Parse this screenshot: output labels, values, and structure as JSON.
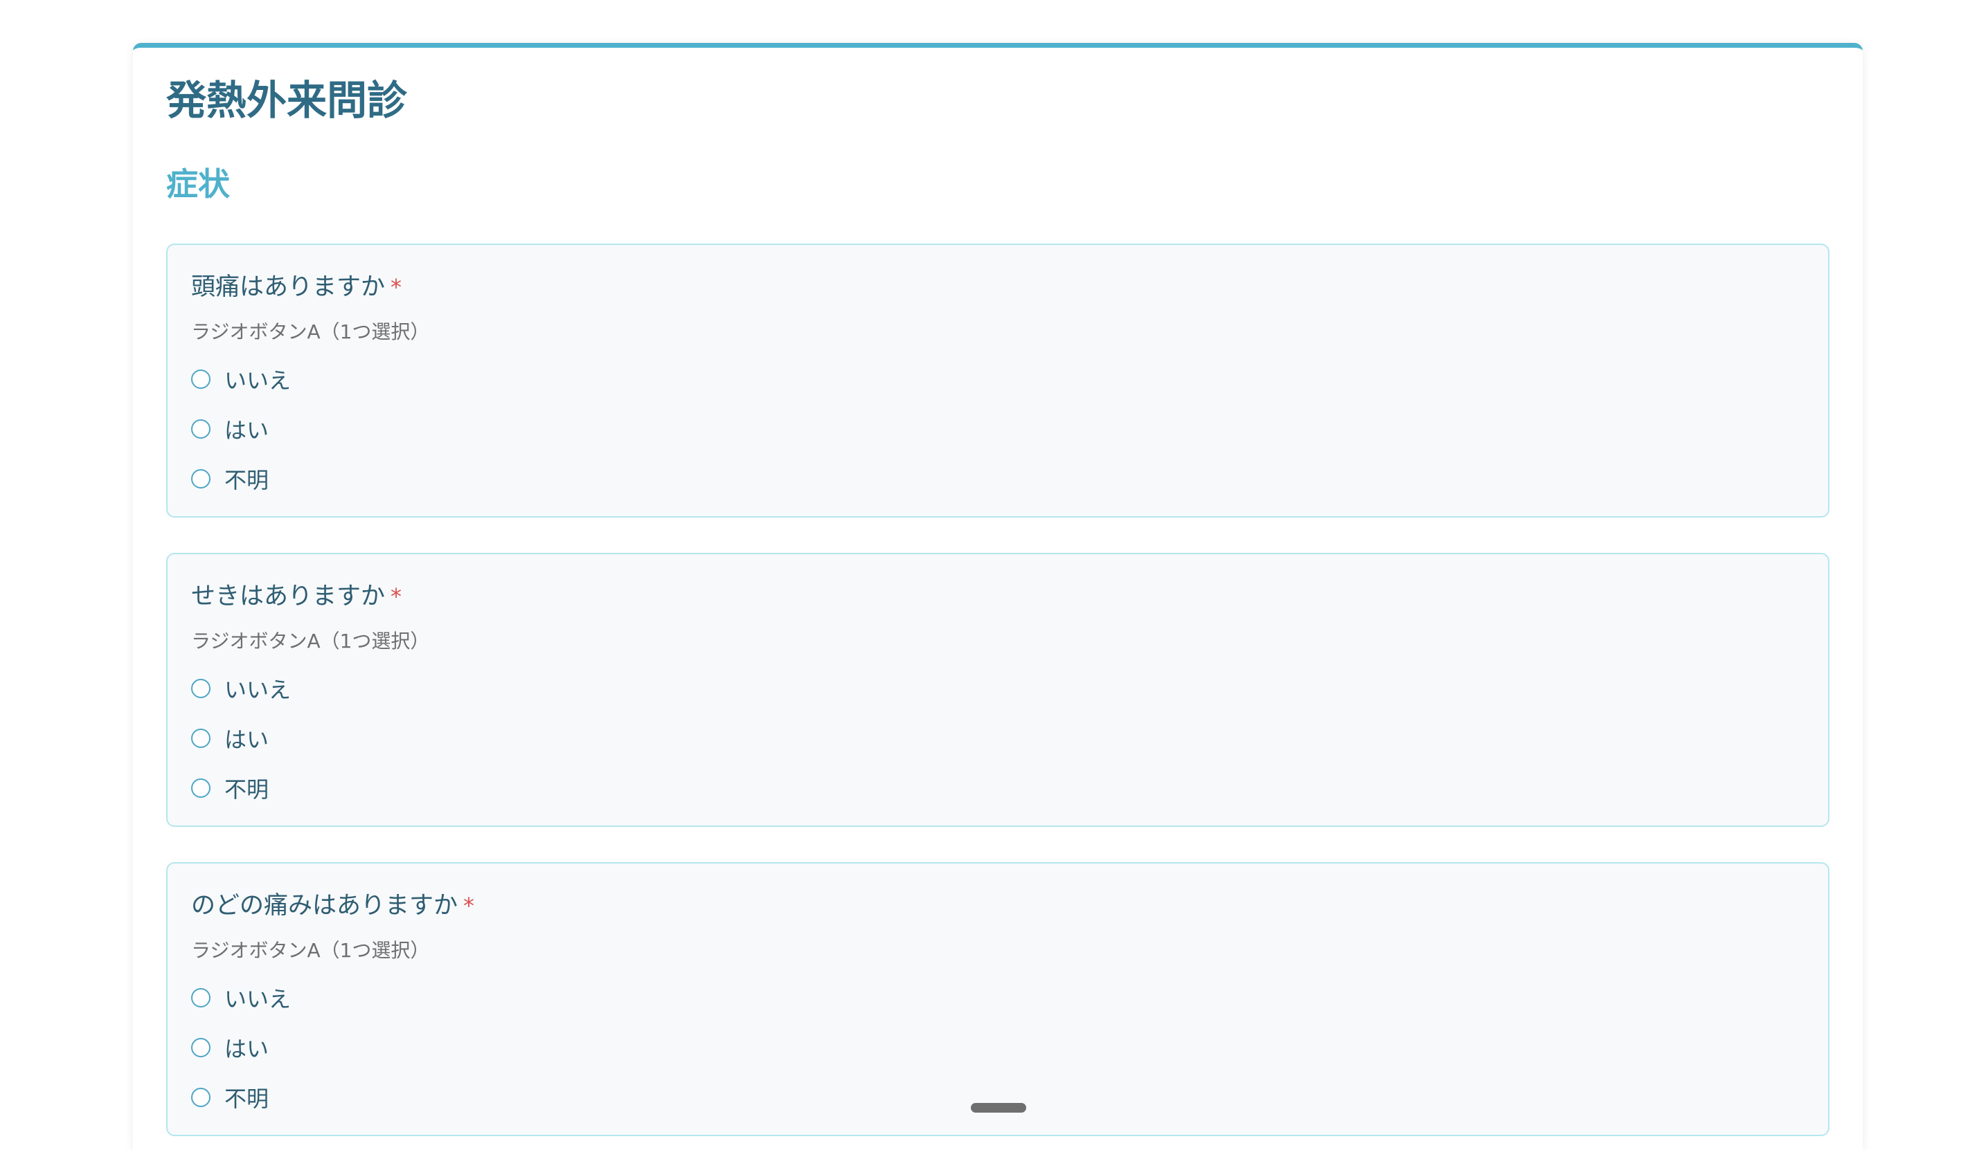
{
  "form": {
    "title": "発熱外来問診",
    "section_title": "症状",
    "questions": [
      {
        "label": "頭痛はありますか",
        "required_mark": "*",
        "hint": "ラジオボタンA（1つ選択）",
        "options": [
          "いいえ",
          "はい",
          "不明"
        ]
      },
      {
        "label": "せきはありますか",
        "required_mark": "*",
        "hint": "ラジオボタンA（1つ選択）",
        "options": [
          "いいえ",
          "はい",
          "不明"
        ]
      },
      {
        "label": "のどの痛みはありますか",
        "required_mark": "*",
        "hint": "ラジオボタンA（1つ選択）",
        "options": [
          "いいえ",
          "はい",
          "不明"
        ]
      }
    ]
  },
  "colors": {
    "accent": "#4fb1cc",
    "title": "#2f6b85",
    "required": "#d9534f",
    "card_border": "#b5e6ee"
  }
}
